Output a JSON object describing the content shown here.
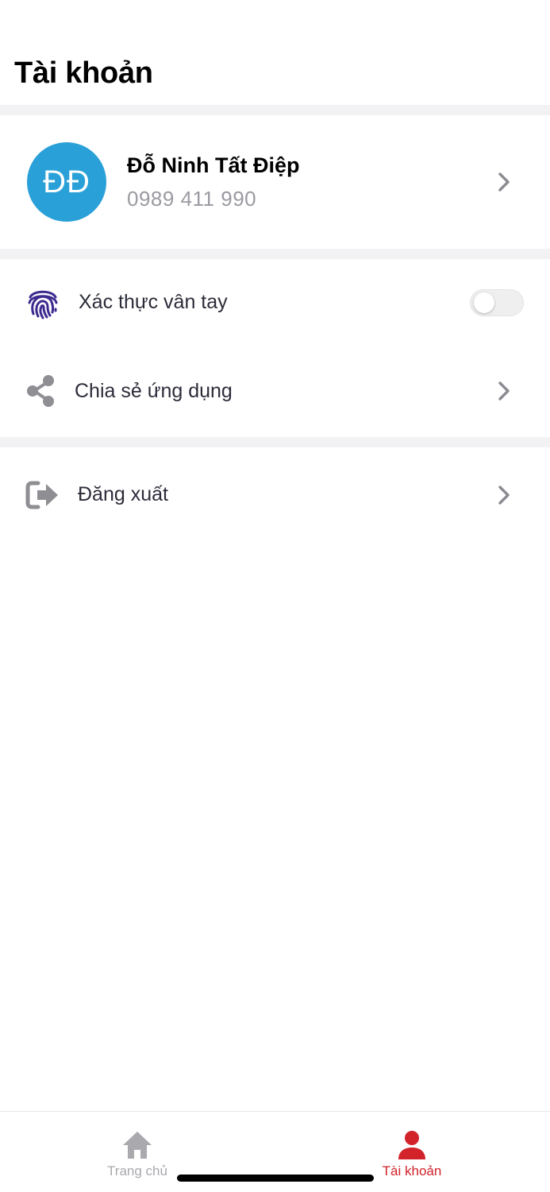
{
  "header": {
    "title": "Tài khoản"
  },
  "profile": {
    "initials": "ĐĐ",
    "name": "Đỗ Ninh Tất Điệp",
    "phone": "0989 411 990",
    "avatar_color": "#2aa0d8"
  },
  "settings": {
    "fingerprint": {
      "label": "Xác thực vân tay",
      "icon": "fingerprint-icon",
      "icon_color": "#3d2a8f",
      "enabled": false
    },
    "share": {
      "label": "Chia sẻ ứng dụng",
      "icon": "share-icon"
    },
    "logout": {
      "label": "Đăng xuất",
      "icon": "logout-icon"
    }
  },
  "tabbar": {
    "tabs": [
      {
        "label": "Trang chủ",
        "icon": "home-icon",
        "active": false,
        "color": "#a9a9ae"
      },
      {
        "label": "Tài khoản",
        "icon": "user-icon",
        "active": true,
        "color": "#d2232a"
      }
    ]
  }
}
